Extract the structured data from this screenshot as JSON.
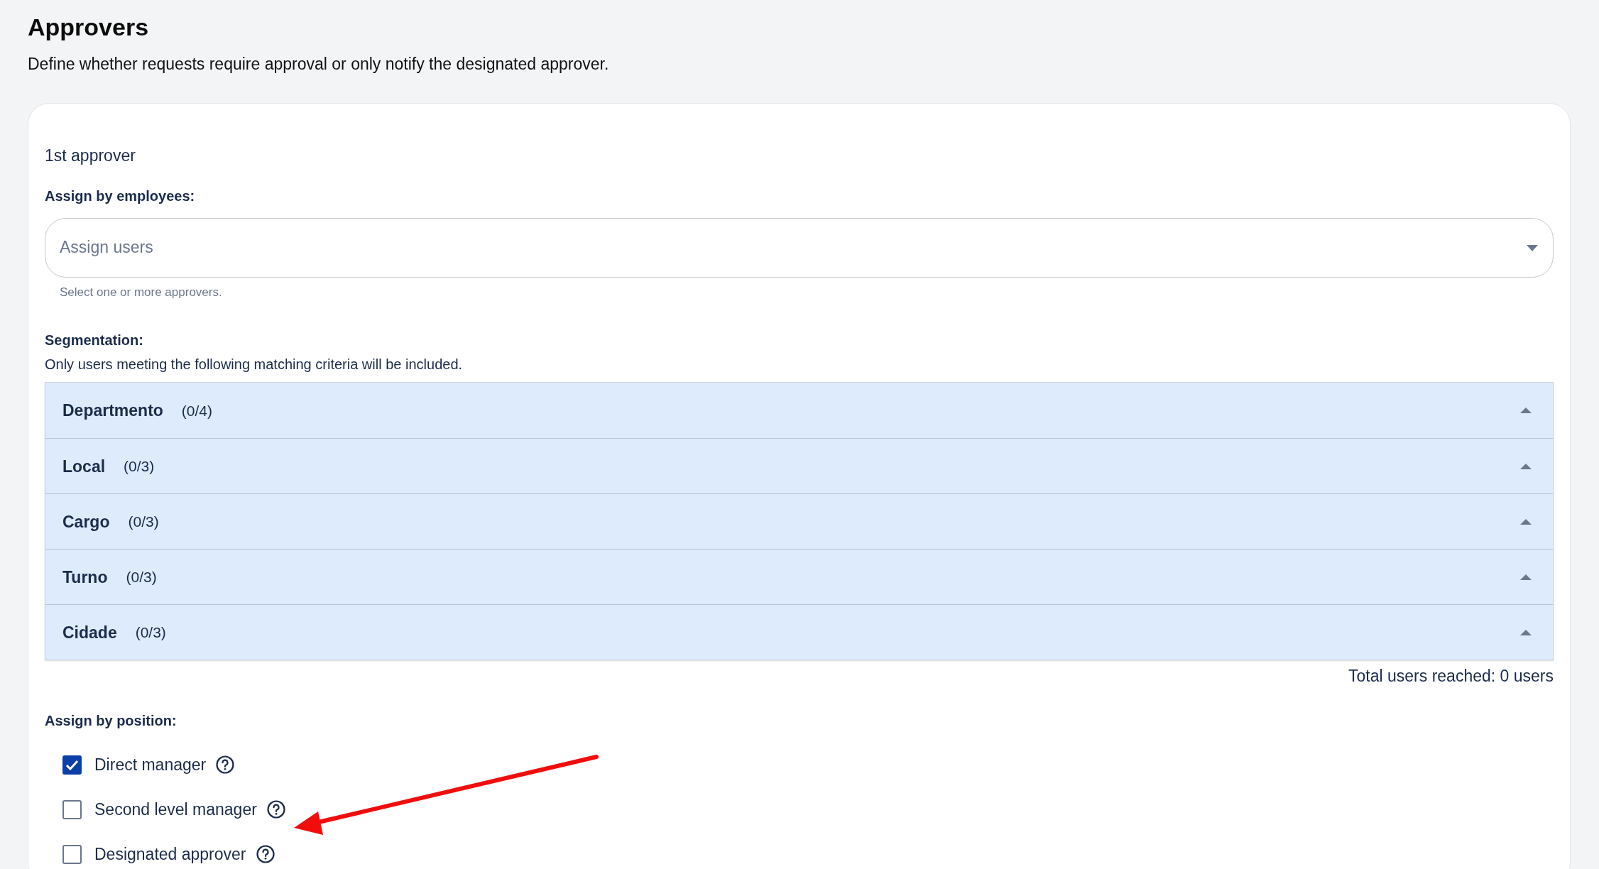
{
  "header": {
    "title": "Approvers",
    "description": "Define whether requests require approval or only notify the designated approver."
  },
  "approver": {
    "title": "1st approver",
    "employees": {
      "label": "Assign by employees:",
      "placeholder": "Assign users",
      "help": "Select one or more approvers."
    },
    "segmentation": {
      "label": "Segmentation:",
      "description": "Only users meeting the following matching criteria will be included.",
      "groups": [
        {
          "name": "Departmento",
          "count": "(0/4)",
          "expanded": false
        },
        {
          "name": "Local",
          "count": "(0/3)",
          "expanded": false
        },
        {
          "name": "Cargo",
          "count": "(0/3)",
          "expanded": false
        },
        {
          "name": "Turno",
          "count": "(0/3)",
          "expanded": false
        },
        {
          "name": "Cidade",
          "count": "(0/3)",
          "expanded": false
        }
      ],
      "total": "Total users reached: 0 users"
    },
    "position": {
      "label": "Assign by position:",
      "options": [
        {
          "label": "Direct manager",
          "checked": true
        },
        {
          "label": "Second level manager",
          "checked": false
        },
        {
          "label": "Designated approver",
          "checked": false
        }
      ]
    }
  }
}
